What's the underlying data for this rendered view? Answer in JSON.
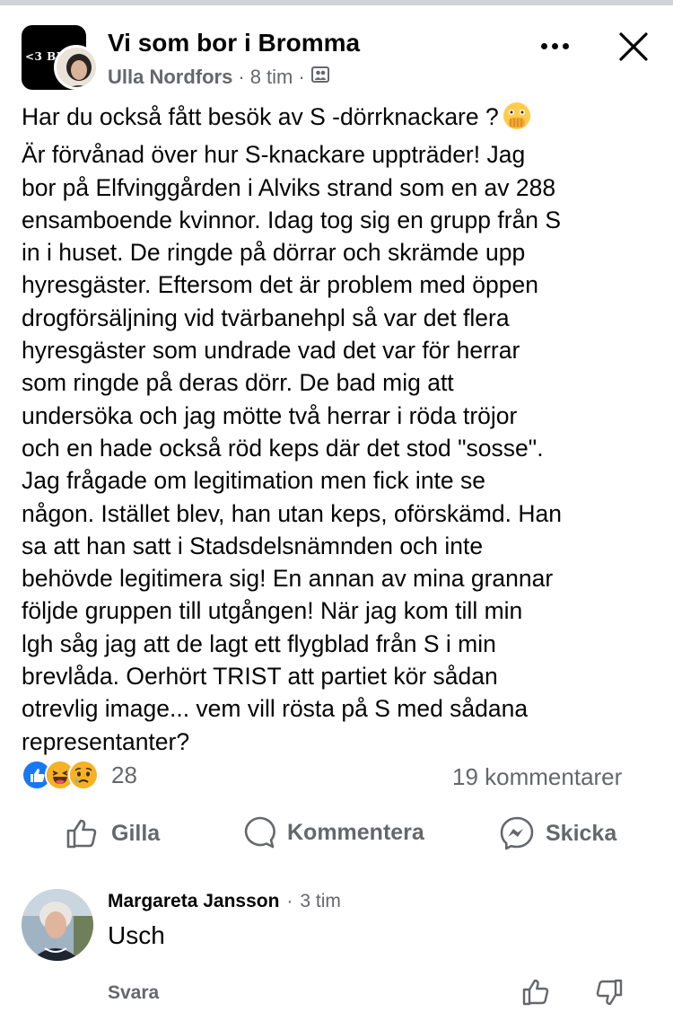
{
  "header": {
    "group_name": "Vi som bor i Bromma",
    "group_logo_text": "<3 BRO",
    "author": "Ulla Nordfors",
    "separator": "·",
    "time": "8 tim",
    "audience_icon": "group-icon",
    "more_icon": "more-horizontal-icon",
    "close_icon": "close-icon"
  },
  "post": {
    "lines": [
      "Har du också fått besök av S -dörrknackare ?",
      "Är förvånad över hur S-knackare uppträder! Jag",
      "bor på Elfvinggården i Alviks strand som en av 288",
      "ensamboende kvinnor. Idag tog sig en grupp från S",
      "in i huset. De ringde på dörrar och skrämde upp",
      "hyresgäster. Eftersom det är problem med öppen",
      "drogförsäljning vid tvärbanehpl så var det flera",
      "hyresgäster som undrade vad det var för herrar",
      "som ringde på deras dörr. De bad mig att",
      "undersöka och jag mötte två herrar i röda tröjor",
      "och en hade också röd keps där det stod \"sosse\".",
      "Jag frågade om legitimation men fick inte se",
      "någon. Istället blev, han utan keps, oförskämd. Han",
      "sa att han satt i Stadsdelsnämnden och inte",
      "behövde legitimera sig! En annan av mina grannar",
      "följde gruppen till utgången! När jag kom till min",
      "lgh såg jag att de lagt ett flygblad från S i min",
      "brevlåda. Oerhört TRIST att partiet kör sådan",
      "otrevlig image... vem vill rösta på S med sådana",
      "representanter?"
    ],
    "emoji": "face-with-open-eyes-and-hand-over-mouth"
  },
  "stats": {
    "reaction_types": [
      "like",
      "haha",
      "sad"
    ],
    "reaction_count": "28",
    "comment_count": "19 kommentarer"
  },
  "actions": {
    "like": "Gilla",
    "comment": "Kommentera",
    "send": "Skicka"
  },
  "comment": {
    "author": "Margareta Jansson",
    "separator": "·",
    "time": "3 tim",
    "text": "Usch",
    "reply": "Svara"
  },
  "colors": {
    "text": "#050505",
    "secondary": "#65676b",
    "like_blue": "#1877f2",
    "haha_yellow": "#f7b125"
  }
}
